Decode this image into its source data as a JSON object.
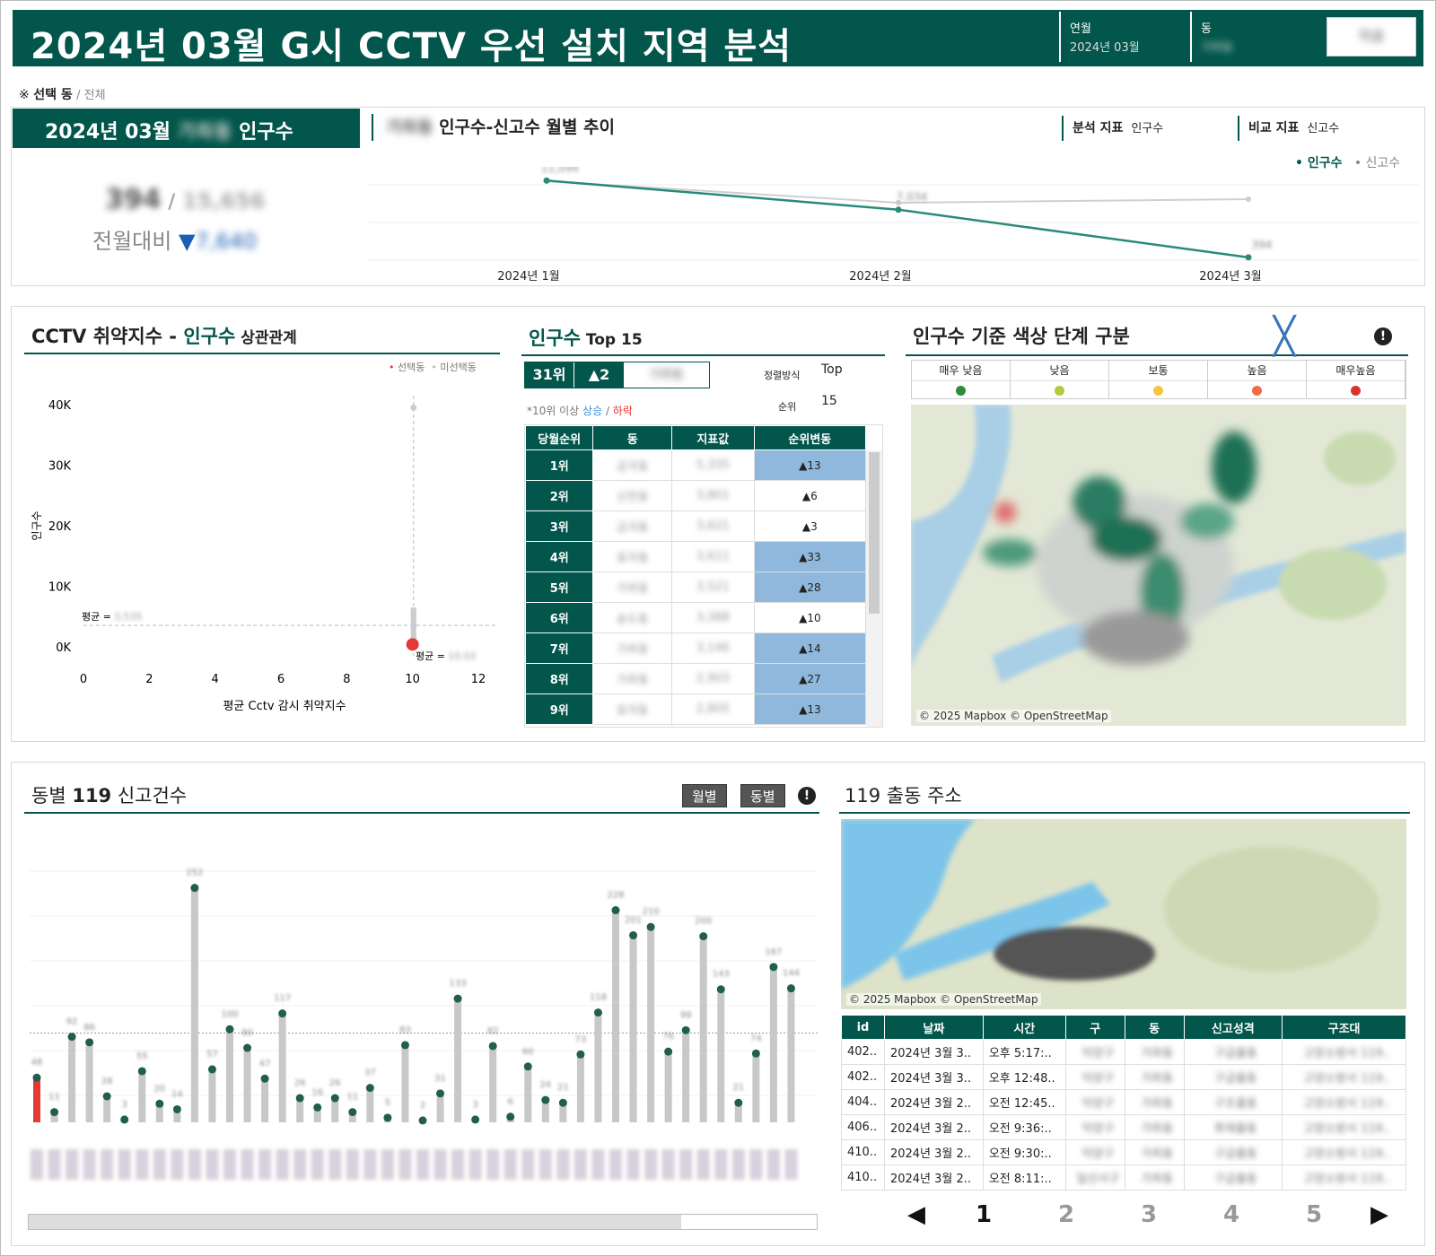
{
  "header": {
    "title": "2024년 03월 G시 CCTV 우선 설치 지역 분석",
    "month_label": "연월",
    "month_value": "2024년 03월",
    "dong_label": "동",
    "dong_value": "가좌동",
    "apply_button": "적용"
  },
  "breadcrumb": {
    "label": "선택 동",
    "value": "/ 전체"
  },
  "population_card": {
    "title": "2024년 03월",
    "dong": "가좌동",
    "suffix": "인구수",
    "value": "394",
    "total": "15,656",
    "compare_label": "전월대비",
    "delta": "7,640"
  },
  "trend": {
    "dong": "가좌동",
    "title": "인구수-신고수 월별 추이",
    "analysis_label": "분석 지표",
    "analysis_value": "인구수",
    "compare_label": "비교 지표",
    "compare_value": "신고수",
    "legend": [
      "인구수",
      "신고수"
    ],
    "x_labels": [
      "2024년 1월",
      "2024년 2월",
      "2024년 3월"
    ],
    "population": [
      11094,
      7034,
      394
    ],
    "reports": [
      null,
      null,
      null
    ],
    "data_labels": [
      "11,094",
      "7,034",
      "394"
    ]
  },
  "scatter": {
    "title_a": "CCTV 취약지수",
    "title_sep": " - ",
    "title_b": "인구수",
    "title_c": " 상관관계",
    "legend_sel": "선택동",
    "legend_unsel": "미선택동",
    "y_ticks": [
      "40K",
      "30K",
      "20K",
      "10K",
      "0K"
    ],
    "x_ticks": [
      "0",
      "2",
      "4",
      "6",
      "8",
      "10",
      "12"
    ],
    "xlabel": "평균 Cctv 감시 취약지수",
    "ylabel": "인구수",
    "avg_label": "평균 =",
    "avg_y": "3,535",
    "avg_x": "10.03"
  },
  "top15": {
    "title_a": "인구수",
    "title_b": " Top 15",
    "rank": "31위",
    "delta": "▲2",
    "dong": "가좌동",
    "sort_label": "정렬방식",
    "sort_value": "Top",
    "rank_label": "순위",
    "rank_value": "15",
    "note": "*10위 이상 ",
    "note_up": "상승",
    "note_sep": " / ",
    "note_down": "하락",
    "columns": [
      "당월순위",
      "동",
      "지표값",
      "순위변동"
    ],
    "rows": [
      {
        "rank": "1위",
        "dong": "금곡동",
        "value": "5,335",
        "change": "▲13",
        "hl": true
      },
      {
        "rank": "2위",
        "dong": "신천동",
        "value": "3,801",
        "change": "▲6",
        "hl": false
      },
      {
        "rank": "3위",
        "dong": "금곡동",
        "value": "3,621",
        "change": "▲3",
        "hl": false
      },
      {
        "rank": "4위",
        "dong": "효자동",
        "value": "3,611",
        "change": "▲33",
        "hl": true
      },
      {
        "rank": "5위",
        "dong": "가좌동",
        "value": "3,521",
        "change": "▲28",
        "hl": true
      },
      {
        "rank": "6위",
        "dong": "송도동",
        "value": "3,388",
        "change": "▲10",
        "hl": false
      },
      {
        "rank": "7위",
        "dong": "가좌동",
        "value": "3,146",
        "change": "▲14",
        "hl": true
      },
      {
        "rank": "8위",
        "dong": "가좌동",
        "value": "2,903",
        "change": "▲27",
        "hl": true
      },
      {
        "rank": "9위",
        "dong": "효자동",
        "value": "2,805",
        "change": "▲13",
        "hl": true
      }
    ]
  },
  "levels": {
    "title": "인구수 기준 색상 단계 구분",
    "items": [
      {
        "label": "매우 낮음",
        "color": "#2e8b3a"
      },
      {
        "label": "낮음",
        "color": "#b5c93a"
      },
      {
        "label": "보통",
        "color": "#f4c542"
      },
      {
        "label": "높음",
        "color": "#f26b43"
      },
      {
        "label": "매우높음",
        "color": "#d9312b"
      }
    ],
    "map_credit": "© 2025 Mapbox © OpenStreetMap"
  },
  "bars": {
    "title_a": "동별 ",
    "title_b": "119",
    "title_c": " 신고건수",
    "btn_month": "월별",
    "btn_dong": "동별",
    "values": [
      48,
      11,
      92,
      86,
      28,
      3,
      55,
      20,
      14,
      252,
      57,
      100,
      80,
      47,
      117,
      26,
      16,
      26,
      11,
      37,
      5,
      83,
      2,
      31,
      133,
      3,
      82,
      6,
      60,
      24,
      21,
      73,
      118,
      228,
      201,
      210,
      76,
      99,
      200,
      143,
      21,
      74,
      167,
      144
    ],
    "labels": [
      "48",
      "11",
      "92",
      "86",
      "28",
      "3",
      "55",
      "20",
      "14",
      "252",
      "57",
      "100",
      "80",
      "47",
      "117",
      "26",
      "16",
      "26",
      "11",
      "37",
      "5",
      "83",
      "2",
      "31",
      "133",
      "3",
      "82",
      "6",
      "60",
      "24",
      "21",
      "73",
      "118",
      "228",
      "201",
      "210",
      "76",
      "99",
      "200",
      "143",
      "21",
      "74",
      "167",
      "144"
    ]
  },
  "dispatch": {
    "title": "119 출동 주소",
    "map_credit": "© 2025 Mapbox © OpenStreetMap",
    "columns": [
      "id",
      "날짜",
      "시간",
      "구",
      "동",
      "신고성격",
      "구조대"
    ],
    "rows": [
      {
        "id": "402..",
        "date": "2024년 3월 3..",
        "time": "오후 5:17:..",
        "gu": "덕양구",
        "dong": "가좌동",
        "type": "구급출동",
        "team": "고양소방서 119.."
      },
      {
        "id": "402..",
        "date": "2024년 3월 3..",
        "time": "오후 12:48..",
        "gu": "덕양구",
        "dong": "가좌동",
        "type": "구급출동",
        "team": "고양소방서 119.."
      },
      {
        "id": "404..",
        "date": "2024년 3월 2..",
        "time": "오전 12:45..",
        "gu": "덕양구",
        "dong": "가좌동",
        "type": "구조출동",
        "team": "고양소방서 119.."
      },
      {
        "id": "406..",
        "date": "2024년 3월 2..",
        "time": "오전 9:36:..",
        "gu": "덕양구",
        "dong": "가좌동",
        "type": "화재출동",
        "team": "고양소방서 119.."
      },
      {
        "id": "410..",
        "date": "2024년 3월 2..",
        "time": "오전 9:30:..",
        "gu": "덕양구",
        "dong": "가좌동",
        "type": "구급출동",
        "team": "고양소방서 119.."
      },
      {
        "id": "410..",
        "date": "2024년 3월 2..",
        "time": "오전 8:11:..",
        "gu": "일산서구",
        "dong": "가좌동",
        "type": "구급출동",
        "team": "고양소방서 119.."
      }
    ],
    "pages": [
      "1",
      "2",
      "3",
      "4",
      "5"
    ],
    "prev": "◀",
    "next": "▶"
  }
}
